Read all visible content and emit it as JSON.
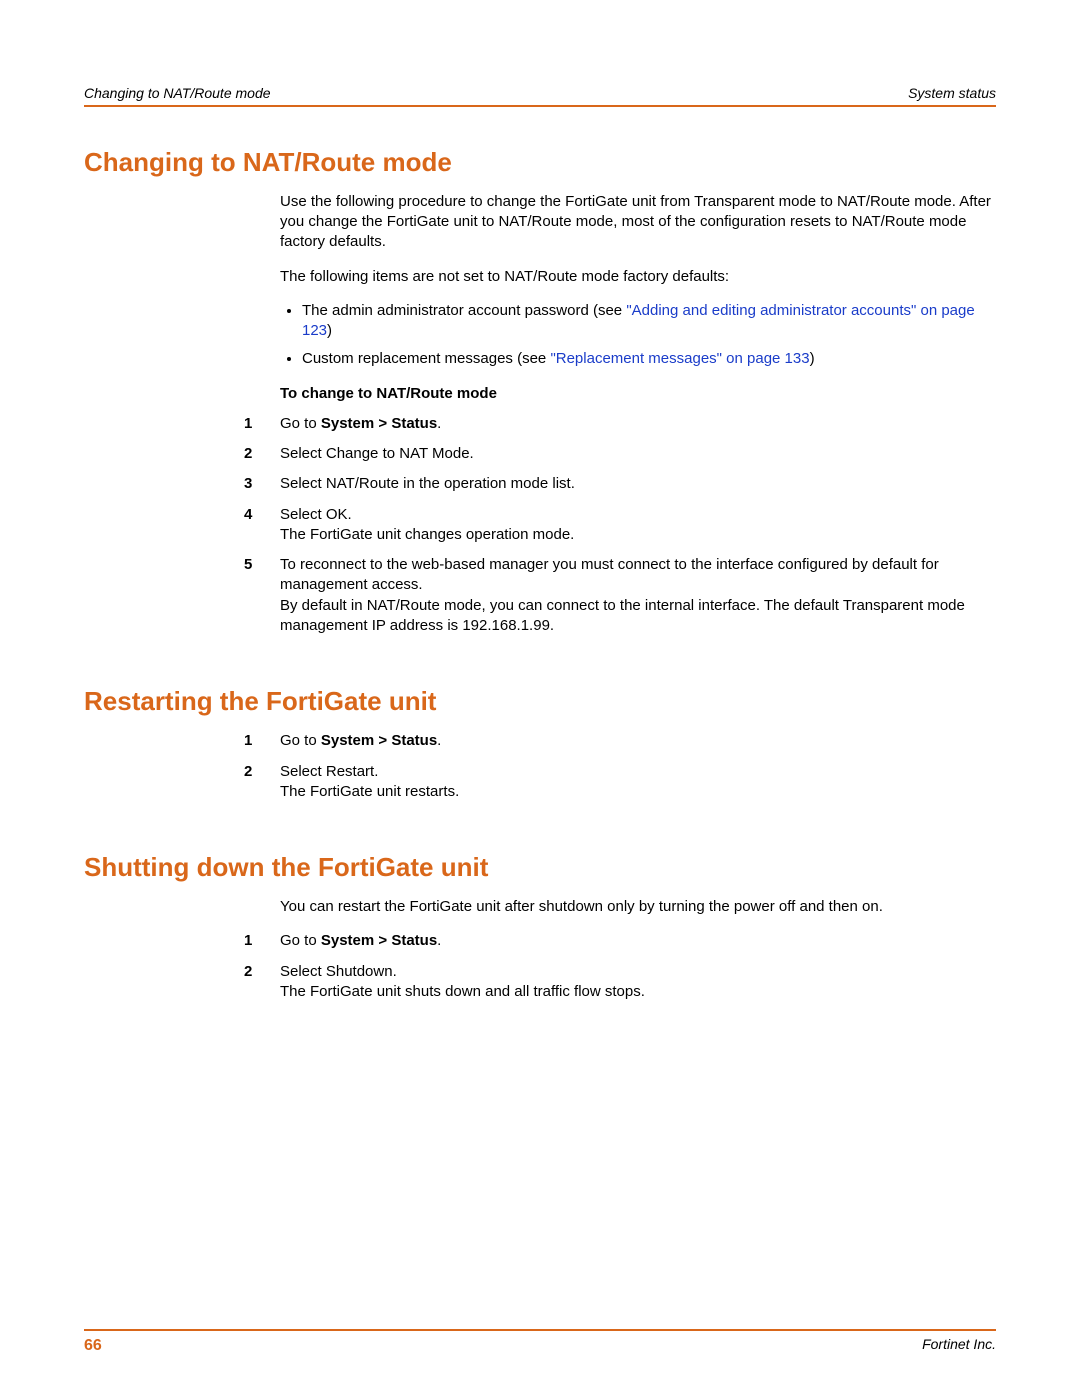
{
  "header": {
    "left": "Changing to NAT/Route mode",
    "right": "System status"
  },
  "sections": [
    {
      "title": "Changing to NAT/Route mode",
      "paras": [
        "Use the following procedure to change the FortiGate unit from Transparent mode to NAT/Route mode. After you change the FortiGate unit to NAT/Route mode, most of the configuration resets to NAT/Route mode factory defaults.",
        "The following items are not set to NAT/Route mode factory defaults:"
      ],
      "bullets": [
        {
          "pre": "The admin administrator account password (see ",
          "link": "\"Adding and editing administrator accounts\" on page 123",
          "post": ")"
        },
        {
          "pre": "Custom replacement messages (see ",
          "link": "\"Replacement messages\" on page 133",
          "post": ")"
        }
      ],
      "subhead": "To change to NAT/Route mode",
      "steps": [
        {
          "n": "1",
          "bold_pre": "Go to ",
          "bold": "System > Status",
          "bold_post": "."
        },
        {
          "n": "2",
          "text": "Select Change to NAT Mode."
        },
        {
          "n": "3",
          "text": "Select NAT/Route in the operation mode list."
        },
        {
          "n": "4",
          "text": "Select OK.",
          "after": "The FortiGate unit changes operation mode."
        },
        {
          "n": "5",
          "text": "To reconnect to the web-based manager you must connect to the interface configured by default for management access.",
          "after": "By default in NAT/Route mode, you can connect to the internal interface. The default Transparent mode management IP address is 192.168.1.99."
        }
      ]
    },
    {
      "title": "Restarting the FortiGate unit",
      "steps": [
        {
          "n": "1",
          "bold_pre": "Go to ",
          "bold": "System > Status",
          "bold_post": "."
        },
        {
          "n": "2",
          "text": "Select Restart.",
          "after": "The FortiGate unit restarts."
        }
      ]
    },
    {
      "title": "Shutting down the FortiGate unit",
      "paras": [
        "You can restart the FortiGate unit after shutdown only by turning the power off and then on."
      ],
      "steps": [
        {
          "n": "1",
          "bold_pre": "Go to ",
          "bold": "System > Status",
          "bold_post": "."
        },
        {
          "n": "2",
          "text": "Select Shutdown.",
          "after": "The FortiGate unit shuts down and all traffic flow stops."
        }
      ]
    }
  ],
  "footer": {
    "page": "66",
    "company": "Fortinet Inc."
  }
}
